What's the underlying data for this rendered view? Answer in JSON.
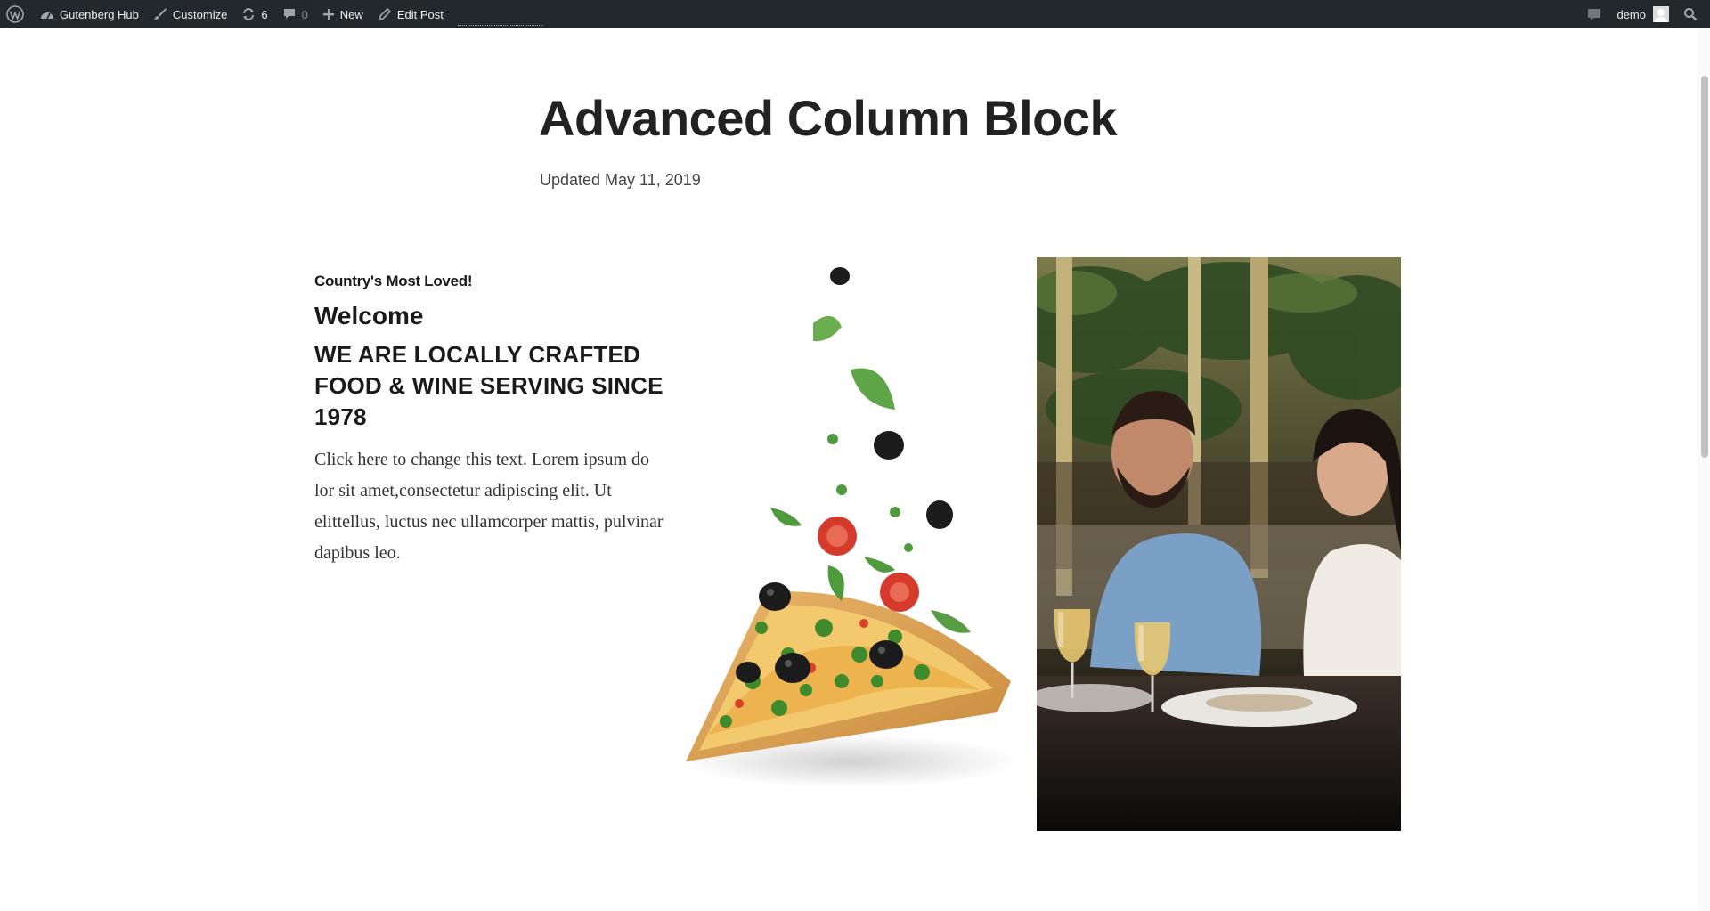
{
  "adminbar": {
    "site_name": "Gutenberg Hub",
    "customize": "Customize",
    "updates_count": "6",
    "comments_count": "0",
    "new_label": "New",
    "edit_post": "Edit Post",
    "user": "demo"
  },
  "post": {
    "title": "Advanced Column Block",
    "meta": "Updated May 11, 2019"
  },
  "content": {
    "eyebrow": "Country's Most Loved!",
    "welcome": "Welcome",
    "headline": "WE ARE LOCALLY CRAFTED FOOD & WINE SERVING SINCE 1978",
    "body": "Click here to change this text. Lorem ipsum do lor sit amet,consectetur adipiscing elit. Ut elittellus, luctus nec ullamcorper mattis, pulvinar dapibus leo."
  },
  "colors": {
    "adminbar_bg": "#23282d",
    "text": "#222222"
  },
  "icons": [
    "wordpress-icon",
    "dashboard-icon",
    "brush-icon",
    "updates-icon",
    "comment-icon",
    "plus-icon",
    "pencil-icon",
    "notification-icon",
    "search-icon"
  ]
}
